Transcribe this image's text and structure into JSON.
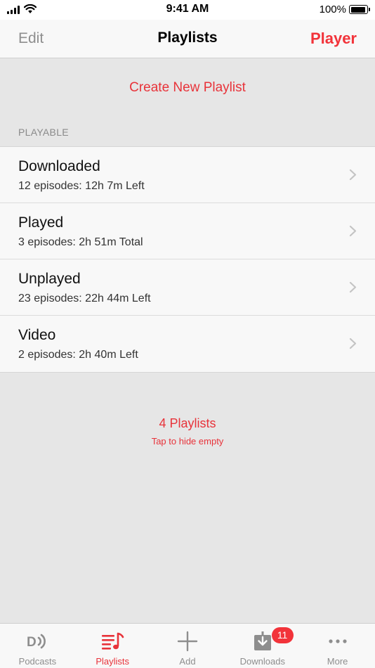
{
  "status_bar": {
    "time": "9:41 AM",
    "battery_pct": "100%"
  },
  "nav": {
    "edit_label": "Edit",
    "title": "Playlists",
    "player_label": "Player"
  },
  "create_label": "Create New Playlist",
  "section_header": "PLAYABLE",
  "playlists": [
    {
      "title": "Downloaded",
      "subtitle": "12 episodes: 12h 7m Left"
    },
    {
      "title": "Played",
      "subtitle": "3 episodes: 2h 51m Total"
    },
    {
      "title": "Unplayed",
      "subtitle": "23 episodes: 22h 44m Left"
    },
    {
      "title": "Video",
      "subtitle": "2 episodes: 2h 40m Left"
    }
  ],
  "footer": {
    "count": "4 Playlists",
    "hint": "Tap to hide empty"
  },
  "tabs": [
    {
      "label": "Podcasts",
      "icon": "podcasts-icon"
    },
    {
      "label": "Playlists",
      "icon": "playlists-icon"
    },
    {
      "label": "Add",
      "icon": "add-icon"
    },
    {
      "label": "Downloads",
      "icon": "downloads-icon",
      "badge": "11"
    },
    {
      "label": "More",
      "icon": "more-icon"
    }
  ],
  "colors": {
    "accent": "#e8333a",
    "inactive": "#8e8e8e",
    "background": "#e6e6e6"
  }
}
